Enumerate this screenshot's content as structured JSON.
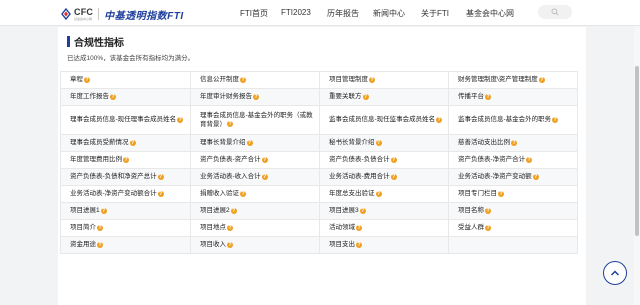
{
  "header": {
    "logo_text": "CFC",
    "logo_sub": "基金会中心网",
    "brand_name": "中基透明指数FTI",
    "nav": [
      "FTI首页",
      "FTI2023",
      "历年报告",
      "新闻中心",
      "关于FTI",
      "基金会中心网"
    ]
  },
  "section": {
    "title": "合规性指标",
    "summary": "已达成100%，该基金会所有指标均为满分。"
  },
  "indicators": [
    [
      "章程",
      "信息公开制度",
      "项目管理制度",
      "财务管理制度\\资产管理制度"
    ],
    [
      "年度工作报告",
      "年度审计财务报告",
      "重要关联方",
      "传播平台"
    ],
    [
      "理事会成员信息-现任理事会成员姓名",
      "理事会成员信息-基金会外的职务（或教育背景）",
      "监事会成员信息-现任监事会成员姓名",
      "监事会成员信息-基金会外的职务"
    ],
    [
      "理事会成员受薪情况",
      "理事长背景介绍",
      "秘书长背景介绍",
      "慈善活动支出比例"
    ],
    [
      "年度管理费用比例",
      "资产负债表-资产合计",
      "资产负债表-负债合计",
      "资产负债表-净资产合计"
    ],
    [
      "资产负债表-负债和净资产总计",
      "业务活动表-收入合计",
      "业务活动表-费用合计",
      "业务活动表-净资产变动额"
    ],
    [
      "业务活动表-净资产变动额合计",
      "捐赠收入验证",
      "年度总支出验证",
      "项目专门栏目"
    ],
    [
      "项目进展1",
      "项目进展2",
      "项目进展3",
      "项目名称"
    ],
    [
      "项目简介",
      "项目地点",
      "活动领域",
      "受益人群"
    ],
    [
      "资金用途",
      "项目收入",
      "项目支出",
      ""
    ]
  ],
  "help_marker": "?",
  "icons": {
    "search": "search-icon",
    "back_to_top": "chevron-up-icon"
  },
  "colors": {
    "brand": "#1f3f9c",
    "help_badge": "#f0a020"
  }
}
